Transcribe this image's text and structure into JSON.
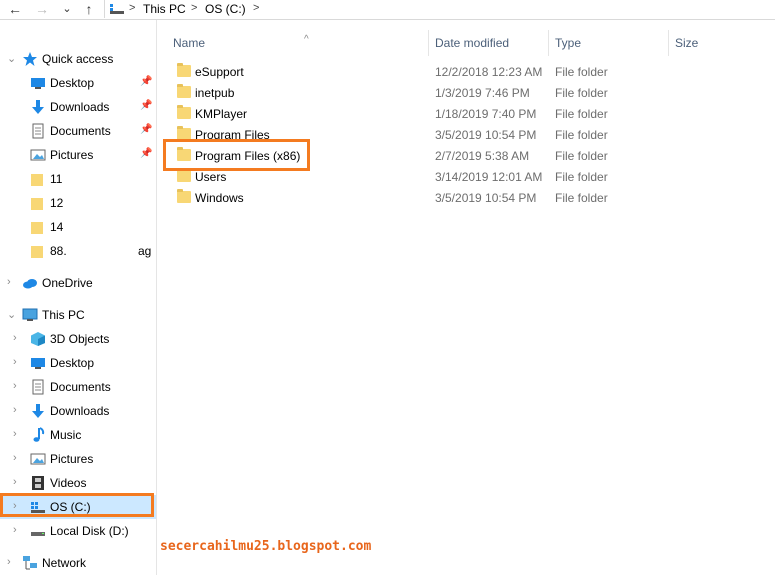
{
  "nav_buttons": {
    "back": "←",
    "forward": "→",
    "recent": "⌄",
    "up": "↑"
  },
  "breadcrumb": {
    "items": [
      "This PC",
      "OS (C:)"
    ],
    "separator": ">"
  },
  "columns": {
    "name": "Name",
    "date": "Date modified",
    "type": "Type",
    "size": "Size"
  },
  "files": [
    {
      "name": "eSupport",
      "date": "12/2/2018 12:23 AM",
      "type": "File folder"
    },
    {
      "name": "inetpub",
      "date": "1/3/2019 7:46 PM",
      "type": "File folder"
    },
    {
      "name": "KMPlayer",
      "date": "1/18/2019 7:40 PM",
      "type": "File folder"
    },
    {
      "name": "Program Files",
      "date": "3/5/2019 10:54 PM",
      "type": "File folder"
    },
    {
      "name": "Program Files (x86)",
      "date": "2/7/2019 5:38 AM",
      "type": "File folder"
    },
    {
      "name": "Users",
      "date": "3/14/2019 12:01 AM",
      "type": "File folder"
    },
    {
      "name": "Windows",
      "date": "3/5/2019 10:54 PM",
      "type": "File folder"
    }
  ],
  "nav": {
    "quick_access": "Quick access",
    "quick_items": [
      "Desktop",
      "Downloads",
      "Documents",
      "Pictures",
      "11",
      "12",
      "14",
      "88."
    ],
    "trailing_text": "ag",
    "onedrive": "OneDrive",
    "this_pc": "This PC",
    "pc_items": [
      "3D Objects",
      "Desktop",
      "Documents",
      "Downloads",
      "Music",
      "Pictures",
      "Videos",
      "OS (C:)",
      "Local Disk (D:)"
    ],
    "network": "Network"
  },
  "watermark": "secercahilmu25.blogspot.com",
  "colors": {
    "highlight": "#f47b20",
    "selected": "#cce8ff",
    "folder": "#f8d775"
  }
}
